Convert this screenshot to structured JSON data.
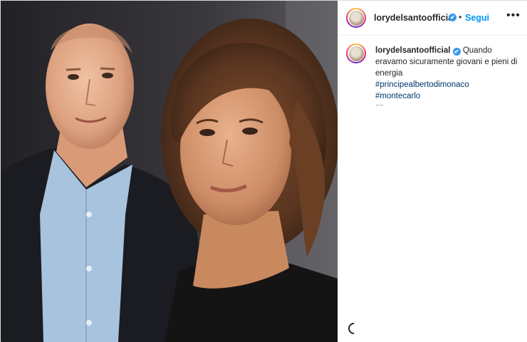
{
  "post": {
    "author": "lorydelsantoofficial",
    "follow_label": "Segui",
    "separator": "•",
    "more_icon": "more-horizontal-icon",
    "verified_icon": "✔"
  },
  "caption": {
    "author": "lorydelsantoofficial",
    "text": "Quando eravamo sicuramente giovani e pieni di energia",
    "hashtags": [
      "#principealbertodimonaco",
      "#montecarlo"
    ],
    "time": "~~"
  },
  "colors": {
    "accent": "#0095f6",
    "hashtag": "#00376b",
    "text": "#262626"
  }
}
